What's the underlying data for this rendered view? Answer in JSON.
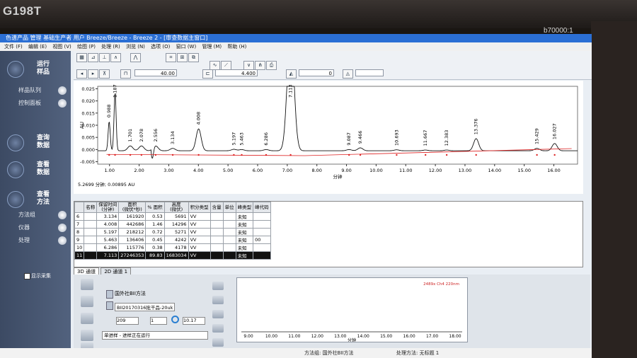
{
  "monitor": {
    "model": "G198T",
    "brand": "b70000:1"
  },
  "window": {
    "title": "色谱产品 管理 基础生产者 用户 Breeze/Breeze - Breeze 2 - [审查数据主窗口]"
  },
  "menu": [
    "文件 (F)",
    "编辑 (E)",
    "视图 (V)",
    "绘图 (P)",
    "处理 (R)",
    "浏览 (N)",
    "选项 (O)",
    "窗口 (W)",
    "管理 (M)",
    "帮助 (H)"
  ],
  "toolbar": {
    "field_a": "40.00",
    "field_b": "4.400",
    "field_c": "0"
  },
  "sidebar": {
    "run_samples": "运行\n样品",
    "sample_queue": "样品队列",
    "control_panel": "控制面板",
    "browse_data": "查询\n数据",
    "review_data": "查看\n数据",
    "view_methods": "查看\n方法",
    "method_group": "方法组",
    "instrument": "仪器",
    "processing": "处理",
    "show_capture": "显示采集"
  },
  "chart_data": {
    "type": "line",
    "xlabel": "分钟",
    "ylabel": "AU",
    "xlim": [
      0.6,
      16.8
    ],
    "ylim": [
      -0.006,
      0.026
    ],
    "yticks": [
      "0.025",
      "0.020",
      "0.015",
      "0.010",
      "0.005",
      "0.000",
      "-0.005"
    ],
    "xticks": [
      "1.00",
      "2.00",
      "3.00",
      "4.00",
      "5.00",
      "6.00",
      "7.00",
      "8.00",
      "9.00",
      "10.00",
      "11.00",
      "12.00",
      "13.00",
      "14.00",
      "15.00",
      "16.00"
    ],
    "peaks": [
      {
        "rt": 0.988,
        "label": "0.988",
        "height": 0.012
      },
      {
        "rt": 1.187,
        "label": "1.187",
        "height": 0.024
      },
      {
        "rt": 1.701,
        "label": "1.701",
        "height": 0.002
      },
      {
        "rt": 2.078,
        "label": "2.078",
        "height": 0.002
      },
      {
        "rt": 2.556,
        "label": "2.556",
        "height": 0.002
      },
      {
        "rt": 3.134,
        "label": "3.134",
        "height": 0.001
      },
      {
        "rt": 4.008,
        "label": "4.008",
        "height": 0.009
      },
      {
        "rt": 5.197,
        "label": "5.197",
        "height": 0.0006
      },
      {
        "rt": 5.463,
        "label": "5.463",
        "height": 0.0005
      },
      {
        "rt": 6.286,
        "label": "6.286",
        "height": 0.0005
      },
      {
        "rt": 7.113,
        "label": "7.113",
        "height": 0.05
      },
      {
        "rt": 9.087,
        "label": "9.087",
        "height": 0.0005
      },
      {
        "rt": 9.466,
        "label": "9.466",
        "height": 0.0012
      },
      {
        "rt": 10.693,
        "label": "10.693",
        "height": 0.0004
      },
      {
        "rt": 11.667,
        "label": "11.667",
        "height": 0.0003
      },
      {
        "rt": 12.383,
        "label": "12.383",
        "height": 0.0003
      },
      {
        "rt": 13.376,
        "label": "13.376",
        "height": 0.005
      },
      {
        "rt": 15.429,
        "label": "15.429",
        "height": 0.001
      },
      {
        "rt": 16.027,
        "label": "16.027",
        "height": 0.003
      }
    ]
  },
  "cursor_readout": "5.2699 分钟; 0.00895 AU",
  "table": {
    "headers": [
      "名称",
      "保留时间\n(分钟)",
      "面积\n(微伏*秒)",
      "% 面积",
      "高度\n(微伏)",
      "积分类型",
      "含量",
      "单位",
      "峰类型",
      "峰代码"
    ],
    "rows": [
      [
        "6",
        "",
        "3.134",
        "161920",
        "0.53",
        "5691",
        "VV",
        "",
        "",
        "未知",
        ""
      ],
      [
        "7",
        "",
        "4.008",
        "442686",
        "1.46",
        "14296",
        "VV",
        "",
        "",
        "未知",
        ""
      ],
      [
        "8",
        "",
        "5.197",
        "218212",
        "0.72",
        "5271",
        "VV",
        "",
        "",
        "未知",
        ""
      ],
      [
        "9",
        "",
        "5.463",
        "136406",
        "0.45",
        "4242",
        "VV",
        "",
        "",
        "未知",
        "00"
      ],
      [
        "10",
        "",
        "6.286",
        "115776",
        "0.38",
        "4178",
        "VV",
        "",
        "",
        "未知",
        ""
      ],
      [
        "11",
        "",
        "7.113",
        "27246353",
        "89.83",
        "1683034",
        "VV",
        "",
        "",
        "未知",
        ""
      ]
    ]
  },
  "tabs": [
    "3D 通道",
    "2D 通道 1"
  ],
  "bottom": {
    "method": "国外社BII方法",
    "sample": "BII20170316批干品-20uk",
    "vial": "209",
    "injection": "1",
    "time": "10.17",
    "status": "单进样 - 进样正在运行",
    "mini_legend": "2489x Ch4 220nm",
    "mini_xticks": [
      "9.00",
      "10.00",
      "11.00",
      "12.00",
      "13.00",
      "14.00",
      "15.00",
      "16.00",
      "17.00",
      "18.00"
    ],
    "mini_xlabel": "分钟"
  },
  "statusbar": {
    "method": "方法组: 国外社BII方法",
    "processing": "处理方法: 无标题 1"
  }
}
